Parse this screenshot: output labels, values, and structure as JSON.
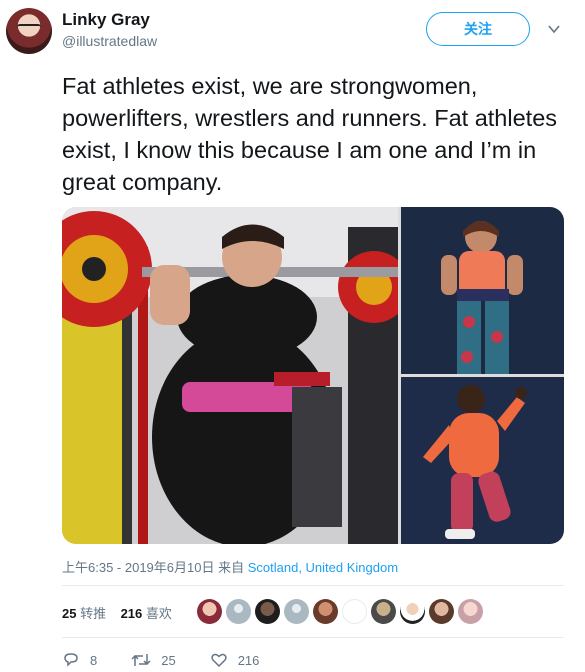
{
  "user": {
    "display_name": "Linky Gray",
    "handle": "@illustratedlaw",
    "follow_label": "关注"
  },
  "tweet": {
    "text": "Fat athletes exist, we are strongwomen, powerlifters, wrestlers and runners. Fat athletes exist, I know this because I am one and I’m in great company.",
    "images": [
      "powerlifter-squat-photo",
      "athlete-portrait-patterned-leggings",
      "runner-orange-top"
    ]
  },
  "meta": {
    "timestamp": "上午6:35 - 2019年6月10日",
    "from_label": "来自",
    "location": "Scotland, United Kingdom"
  },
  "stats": {
    "retweets_count": "25",
    "retweets_label": "转推",
    "likes_count": "216",
    "likes_label": "喜欢"
  },
  "likers": [
    "liker-avatar-1",
    "liker-avatar-2",
    "liker-avatar-3",
    "liker-avatar-4",
    "liker-avatar-5",
    "liker-avatar-6",
    "liker-avatar-7",
    "liker-avatar-8",
    "liker-avatar-9",
    "liker-avatar-10"
  ],
  "actions": {
    "reply_count": "8",
    "retweet_count": "25",
    "like_count": "216"
  },
  "colors": {
    "accent": "#1da1f2",
    "secondary_text": "#657786"
  }
}
